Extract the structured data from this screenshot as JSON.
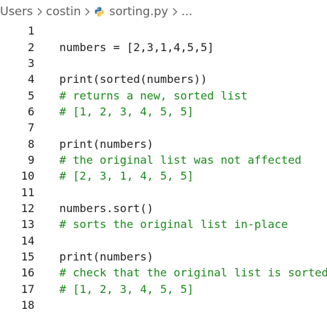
{
  "breadcrumb": {
    "items": [
      "Users",
      "costin",
      "sorting.py",
      "..."
    ],
    "file_icon": "python-icon"
  },
  "editor": {
    "lines": [
      {
        "n": "1",
        "text": ""
      },
      {
        "n": "2",
        "text": "numbers = [2,3,1,4,5,5]"
      },
      {
        "n": "3",
        "text": ""
      },
      {
        "n": "4",
        "text": "print(sorted(numbers))"
      },
      {
        "n": "5",
        "text": "# returns a new, sorted list",
        "comment": true
      },
      {
        "n": "6",
        "text": "# [1, 2, 3, 4, 5, 5]",
        "comment": true
      },
      {
        "n": "7",
        "text": ""
      },
      {
        "n": "8",
        "text": "print(numbers)"
      },
      {
        "n": "9",
        "text": "# the original list was not affected",
        "comment": true
      },
      {
        "n": "10",
        "text": "# [2, 3, 1, 4, 5, 5]",
        "comment": true
      },
      {
        "n": "11",
        "text": ""
      },
      {
        "n": "12",
        "text": "numbers.sort()"
      },
      {
        "n": "13",
        "text": "# sorts the original list in-place",
        "comment": true
      },
      {
        "n": "14",
        "text": ""
      },
      {
        "n": "15",
        "text": "print(numbers)"
      },
      {
        "n": "16",
        "text": "# check that the original list is sorted",
        "comment": true
      },
      {
        "n": "17",
        "text": "# [1, 2, 3, 4, 5, 5]",
        "comment": true
      },
      {
        "n": "18",
        "text": ""
      }
    ]
  },
  "colors": {
    "comment": "#1a8a1a",
    "code": "#1f1f1f",
    "breadcrumb": "#5f5f5f",
    "python_icon_blue": "#3a75b0",
    "python_icon_yellow": "#f2c53d"
  }
}
